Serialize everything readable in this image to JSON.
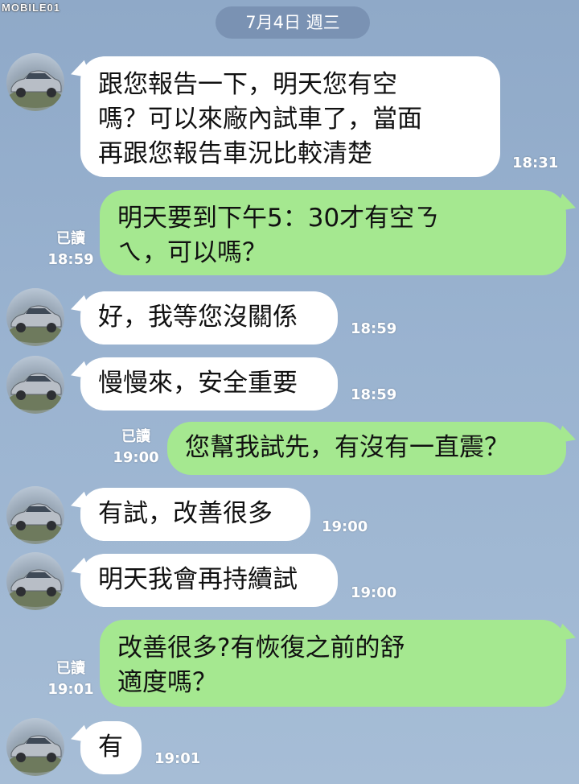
{
  "watermark": "MOBILE01",
  "date_header": "7月4日 週三",
  "messages": [
    {
      "side": "in",
      "text": "跟您報告一下，明天您有空\n嗎？可以來廠內試車了，當面\n再跟您報告車況比較清楚",
      "time": "18:31"
    },
    {
      "side": "out",
      "text": "明天要到下午5：30才有空ㄋ\nㄟ，可以嗎？",
      "read": "已讀",
      "time": "18:59"
    },
    {
      "side": "in",
      "text": "好，我等您沒關係",
      "time": "18:59"
    },
    {
      "side": "in",
      "text": "慢慢來，安全重要",
      "time": "18:59"
    },
    {
      "side": "out",
      "text": "您幫我試先，有沒有一直震？",
      "read": "已讀",
      "time": "19:00"
    },
    {
      "side": "in",
      "text": "有試，改善很多",
      "time": "19:00"
    },
    {
      "side": "in",
      "text": "明天我會再持續試",
      "time": "19:00"
    },
    {
      "side": "out",
      "text": "改善很多?有恢復之前的舒\n適度嗎？",
      "read": "已讀",
      "time": "19:01"
    },
    {
      "side": "in",
      "text": "有",
      "time": "19:01"
    }
  ],
  "colors": {
    "incoming_bubble": "#ffffff",
    "outgoing_bubble": "#a5e890",
    "background": "#9ab3d0"
  },
  "icons": {
    "avatar": "car-avatar-icon"
  }
}
